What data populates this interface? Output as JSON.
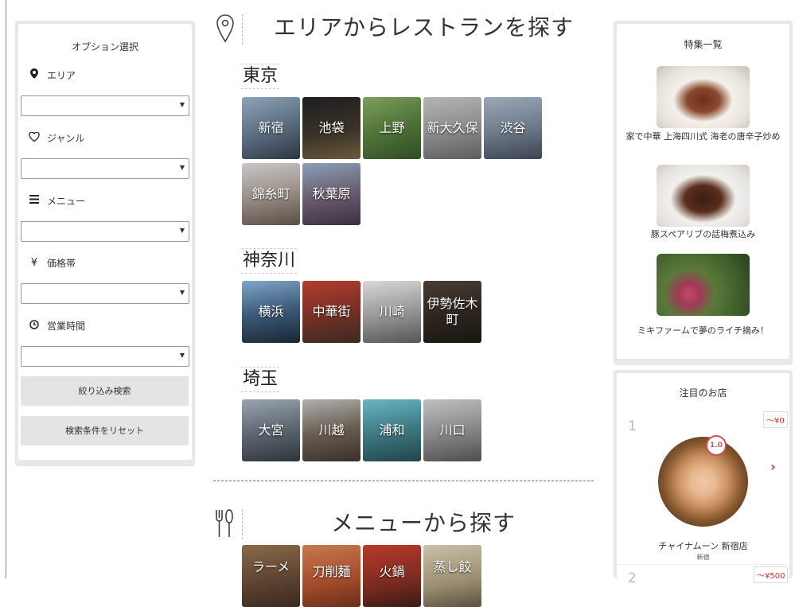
{
  "sidebar": {
    "title": "オプション選択",
    "options": [
      {
        "label": "エリア",
        "icon": "map-pin-icon",
        "value": ""
      },
      {
        "label": "ジャンル",
        "icon": "heart-icon",
        "value": ""
      },
      {
        "label": "メニュー",
        "icon": "menu-bars-icon",
        "value": ""
      },
      {
        "label": "価格帯",
        "icon": "yen-icon",
        "value": ""
      },
      {
        "label": "営業時間",
        "icon": "clock-icon",
        "value": ""
      }
    ],
    "search_button": "絞り込み検索",
    "reset_button": "検索条件をリセット"
  },
  "area_section": {
    "title": "エリアからレストランを探す",
    "regions": [
      {
        "name": "東京",
        "areas": [
          "新宿",
          "池袋",
          "上野",
          "新大久保",
          "渋谷",
          "錦糸町",
          "秋葉原"
        ]
      },
      {
        "name": "神奈川",
        "areas": [
          "横浜",
          "中華街",
          "川崎",
          "伊勢佐木町"
        ]
      },
      {
        "name": "埼玉",
        "areas": [
          "大宮",
          "川越",
          "浦和",
          "川口"
        ]
      }
    ]
  },
  "menu_section": {
    "title": "メニューから探す",
    "items": [
      "ラーメ",
      "刀削麺",
      "火鍋",
      "蒸し餃"
    ]
  },
  "features": {
    "title": "特集一覧",
    "items": [
      "家で中華 上海四川式 海老の唐辛子炒め",
      "豚スペアリブの話梅煮込み",
      "ミキファームで夢のライチ摘み！"
    ]
  },
  "popular": {
    "title": "注目のお店",
    "shops": [
      {
        "rank": "1",
        "price": "～¥0",
        "score": "1.0",
        "name": "チャイナムーン 新宿店",
        "area": "新宿"
      },
      {
        "rank": "2",
        "price": "～¥500"
      }
    ]
  },
  "colors": {
    "accent": "#cc3333",
    "panel_border": "#e8e8e8",
    "button_bg": "#e4e4e4"
  }
}
